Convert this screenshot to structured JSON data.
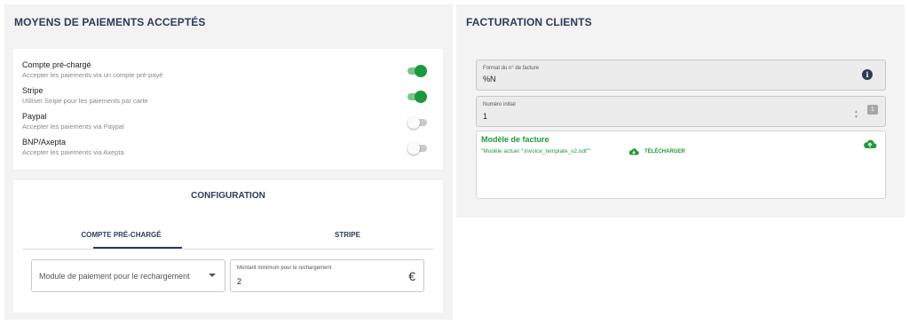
{
  "payment_methods": {
    "title": "MOYENS DE PAIEMENTS ACCEPTÉS",
    "items": [
      {
        "name": "Compte pré-chargé",
        "description": "Accepter les paiements via un compte pré-payé",
        "enabled": true
      },
      {
        "name": "Stripe",
        "description": "Utiliser Stripe pour les paiements par carte",
        "enabled": true
      },
      {
        "name": "Paypal",
        "description": "Accepter les paiements via Paypal",
        "enabled": false
      },
      {
        "name": "BNP/Axepta",
        "description": "Accepter les paiements via Axepta",
        "enabled": false
      }
    ]
  },
  "configuration": {
    "title": "CONFIGURATION",
    "tabs": [
      {
        "label": "COMPTE PRÉ-CHARGÉ",
        "active": true
      },
      {
        "label": "STRIPE",
        "active": false
      }
    ],
    "module_select": {
      "value": "Module de paiement pour le rechargement",
      "icon": "chevron-down-icon"
    },
    "minimum_amount": {
      "label": "Montant minimum pour le rechargement",
      "value": "2",
      "icon": "euro-icon"
    }
  },
  "billing": {
    "title": "FACTURATION CLIENTS",
    "invoice_format": {
      "label": "Format du n° de facture",
      "value": "%N",
      "icon": "info-icon"
    },
    "initial_number": {
      "label": "Numéro initial",
      "value": "1",
      "badge": "1"
    },
    "template": {
      "title": "Modèle de facture",
      "current": "\"Modèle actuel \":invoice_template_v2.odt\"\"",
      "download_label": "TÉLÉCHARGER",
      "download_icon": "cloud-download-icon",
      "upload_icon": "cloud-upload-icon"
    }
  },
  "colors": {
    "accent_green": "#1e9a3a",
    "title_navy": "#2f3a5a",
    "panel_bg": "#f3f3f4"
  }
}
